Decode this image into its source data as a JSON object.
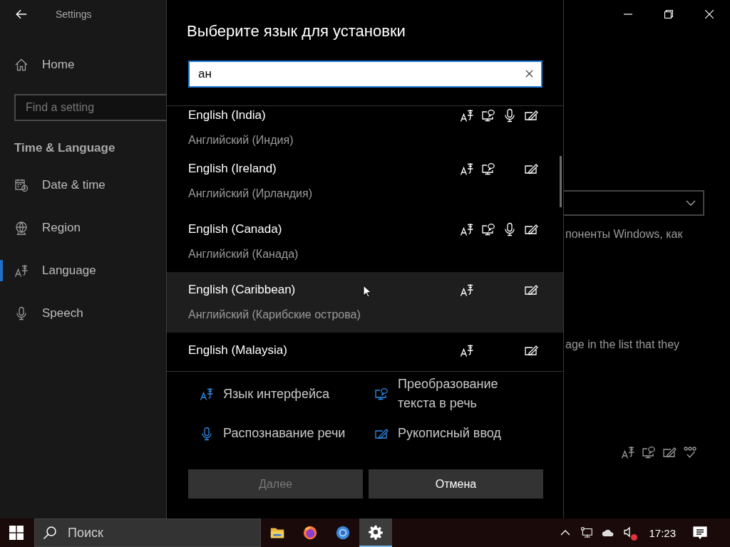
{
  "sidebar": {
    "title": "Settings",
    "home": "Home",
    "search": {
      "placeholder": "Find a setting"
    },
    "section": "Time & Language",
    "items": [
      {
        "kind": "date",
        "label": "Date & time",
        "selected": false
      },
      {
        "kind": "region",
        "label": "Region",
        "selected": false
      },
      {
        "kind": "language",
        "label": "Language",
        "selected": true
      },
      {
        "kind": "speech",
        "label": "Speech",
        "selected": false
      }
    ]
  },
  "dialog": {
    "title": "Выберите язык для установки",
    "search": {
      "value": "ан"
    },
    "languages": [
      {
        "name": "English (India)",
        "native": "Английский (Индия)",
        "highlighted": false,
        "features": {
          "display": true,
          "tts": true,
          "speech": true,
          "handwriting": true
        }
      },
      {
        "name": "English (Ireland)",
        "native": "Английский (Ирландия)",
        "highlighted": false,
        "features": {
          "display": true,
          "tts": true,
          "speech": false,
          "handwriting": true
        }
      },
      {
        "name": "English (Canada)",
        "native": "Английский (Канада)",
        "highlighted": false,
        "features": {
          "display": true,
          "tts": true,
          "speech": true,
          "handwriting": true
        }
      },
      {
        "name": "English (Caribbean)",
        "native": "Английский (Карибские острова)",
        "highlighted": true,
        "features": {
          "display": true,
          "tts": false,
          "speech": false,
          "handwriting": true
        }
      },
      {
        "name": "English (Malaysia)",
        "highlighted": false,
        "features": {
          "display": true,
          "tts": false,
          "speech": false,
          "handwriting": true
        }
      }
    ],
    "legend": [
      {
        "kind": "display",
        "label": "Язык интерфейса"
      },
      {
        "kind": "speech",
        "label": "Распознавание речи"
      },
      {
        "kind": "tts",
        "label": "Преобразование текста в речь"
      },
      {
        "kind": "handwriting",
        "label": "Рукописный ввод"
      }
    ],
    "buttons": [
      {
        "label": "Далее",
        "disabled": true
      },
      {
        "label": "Отмена",
        "disabled": false
      }
    ]
  },
  "background_page": {
    "text_1": "поненты Windows, как",
    "text_2": "age in the list that they"
  },
  "taskbar": {
    "search": {
      "placeholder": "Поиск"
    },
    "apps": [
      {
        "kind": "folder",
        "active": false
      },
      {
        "kind": "firefox",
        "active": false
      },
      {
        "kind": "ring",
        "active": false
      },
      {
        "kind": "settings",
        "active": true
      }
    ],
    "tray": {
      "volume_muted": true,
      "clock": "17:23"
    }
  }
}
